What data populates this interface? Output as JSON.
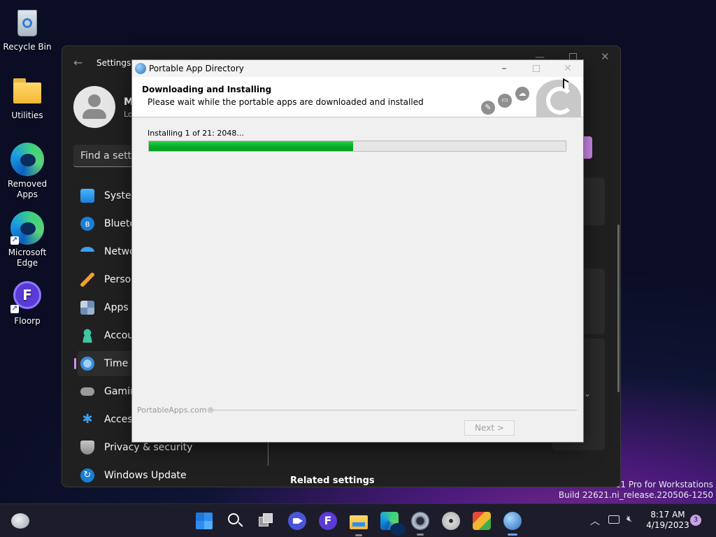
{
  "desktop": {
    "icons": [
      {
        "label": "Recycle Bin"
      },
      {
        "label": "Utilities"
      },
      {
        "label": "Removed Apps"
      },
      {
        "label": "Microsoft Edge"
      },
      {
        "label": "Floorp"
      }
    ],
    "watermark_line1": "s 11 Pro for Workstations",
    "watermark_line2": "Build 22621.ni_release.220506-1250"
  },
  "settings": {
    "title": "Settings",
    "user_initial": "M",
    "user_sub": "Lo",
    "search_placeholder": "Find a settin",
    "nav": [
      {
        "label": "System",
        "icon": "monitor-icon"
      },
      {
        "label": "Bluetoo",
        "icon": "bluetooth-icon"
      },
      {
        "label": "Netwo",
        "icon": "wifi-icon"
      },
      {
        "label": "Person",
        "icon": "brush-icon"
      },
      {
        "label": "Apps",
        "icon": "apps-icon"
      },
      {
        "label": "Accou",
        "icon": "account-icon"
      },
      {
        "label": "Time &",
        "icon": "clock-icon"
      },
      {
        "label": "Gamin",
        "icon": "gamepad-icon"
      },
      {
        "label": "Access",
        "icon": "accessibility-icon"
      },
      {
        "label": "Privacy & security",
        "icon": "shield-icon"
      },
      {
        "label": "Windows Update",
        "icon": "update-icon"
      }
    ],
    "related_settings": "Related settings"
  },
  "dialog": {
    "title": "Portable App Directory",
    "header_title": "Downloading and Installing",
    "header_subtitle": "Please wait while the portable apps are downloaded and installed",
    "status": "Installing 1 of 21: 2048...",
    "progress_percent": 49,
    "brand": "PortableApps.com®",
    "next_label": "Next >"
  },
  "taskbar": {
    "time": "8:17 AM",
    "date": "4/19/2023",
    "notification_count": "3",
    "apps": [
      "start-icon",
      "search-icon",
      "task-view-icon",
      "zoom-icon",
      "floorp-icon",
      "file-explorer-icon",
      "edge-icon",
      "settings-icon",
      "disk-icon",
      "package-icon",
      "portableapps-icon"
    ]
  }
}
